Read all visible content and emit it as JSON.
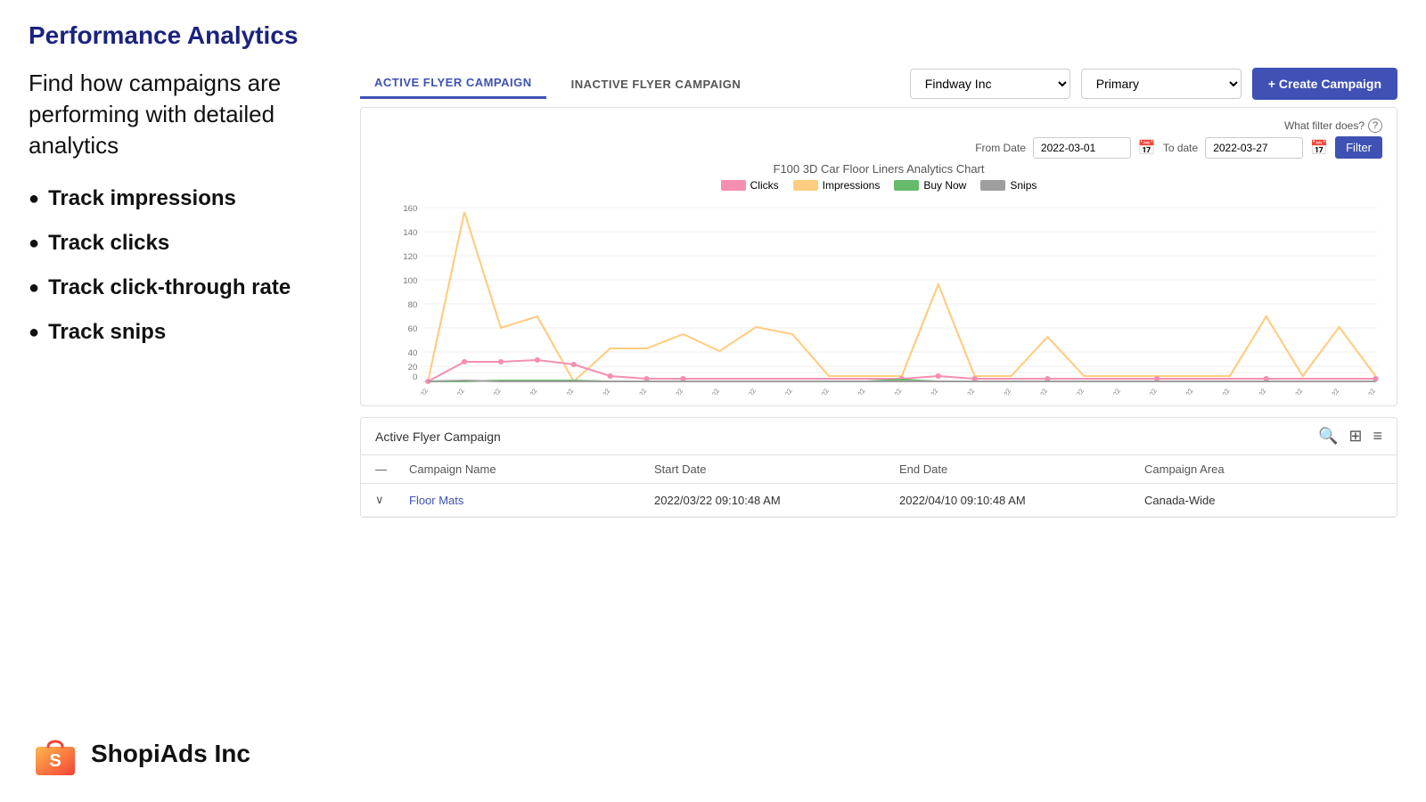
{
  "page": {
    "title": "Performance Analytics"
  },
  "left": {
    "description": "Find how campaigns are performing with detailed analytics",
    "features": [
      "Track impressions",
      "Track clicks",
      "Track click-through rate",
      "Track snips"
    ]
  },
  "tabs": [
    {
      "label": "ACTIVE FLYER CAMPAIGN",
      "active": true
    },
    {
      "label": "INACTIVE FLYER CAMPAIGN",
      "active": false
    }
  ],
  "dropdowns": {
    "company": "Findway Inc",
    "type": "Primary"
  },
  "create_button": "+ Create Campaign",
  "filter": {
    "what_filter_label": "What filter does?",
    "from_date_label": "From Date",
    "to_date_label": "To date",
    "from_date": "2022-03-01",
    "to_date": "2022-03-27",
    "button_label": "Filter"
  },
  "chart": {
    "title": "F100 3D Car Floor Liners Analytics Chart",
    "legend": [
      {
        "label": "Clicks",
        "color": "#f48fb1"
      },
      {
        "label": "Impressions",
        "color": "#ffcc80"
      },
      {
        "label": "Buy Now",
        "color": "#66bb6a"
      },
      {
        "label": "Snips",
        "color": "#9e9e9e"
      }
    ],
    "y_labels": [
      "160",
      "140",
      "120",
      "100",
      "80",
      "60",
      "40",
      "20",
      "0"
    ],
    "x_labels": [
      "03/01/2022",
      "03/02/2022",
      "03/03/2022",
      "03/04/2022",
      "03/05/2022",
      "03/06/2022",
      "03/07/2022",
      "03/08/2022",
      "03/09/2022",
      "03/10/2022",
      "03/11/2022",
      "03/12/2022",
      "03/13/2022",
      "03/14/2022",
      "03/15/2022",
      "03/16/2022",
      "03/17/2022",
      "03/18/2022",
      "03/19/2022",
      "03/20/2022",
      "03/21/2022",
      "03/22/2022",
      "03/23/2022",
      "03/24/2022",
      "03/25/2022",
      "03/26/2022",
      "03/27/2022"
    ]
  },
  "table": {
    "section_title": "Active Flyer Campaign",
    "columns": [
      "Campaign Name",
      "Start Date",
      "End Date",
      "Campaign Area"
    ],
    "rows": [
      {
        "name": "Floor Mats",
        "start_date": "2022/03/22 09:10:48 AM",
        "end_date": "2022/04/10 09:10:48 AM",
        "area": "Canada-Wide"
      }
    ]
  },
  "logo": {
    "company_name": "ShopiAds Inc"
  }
}
